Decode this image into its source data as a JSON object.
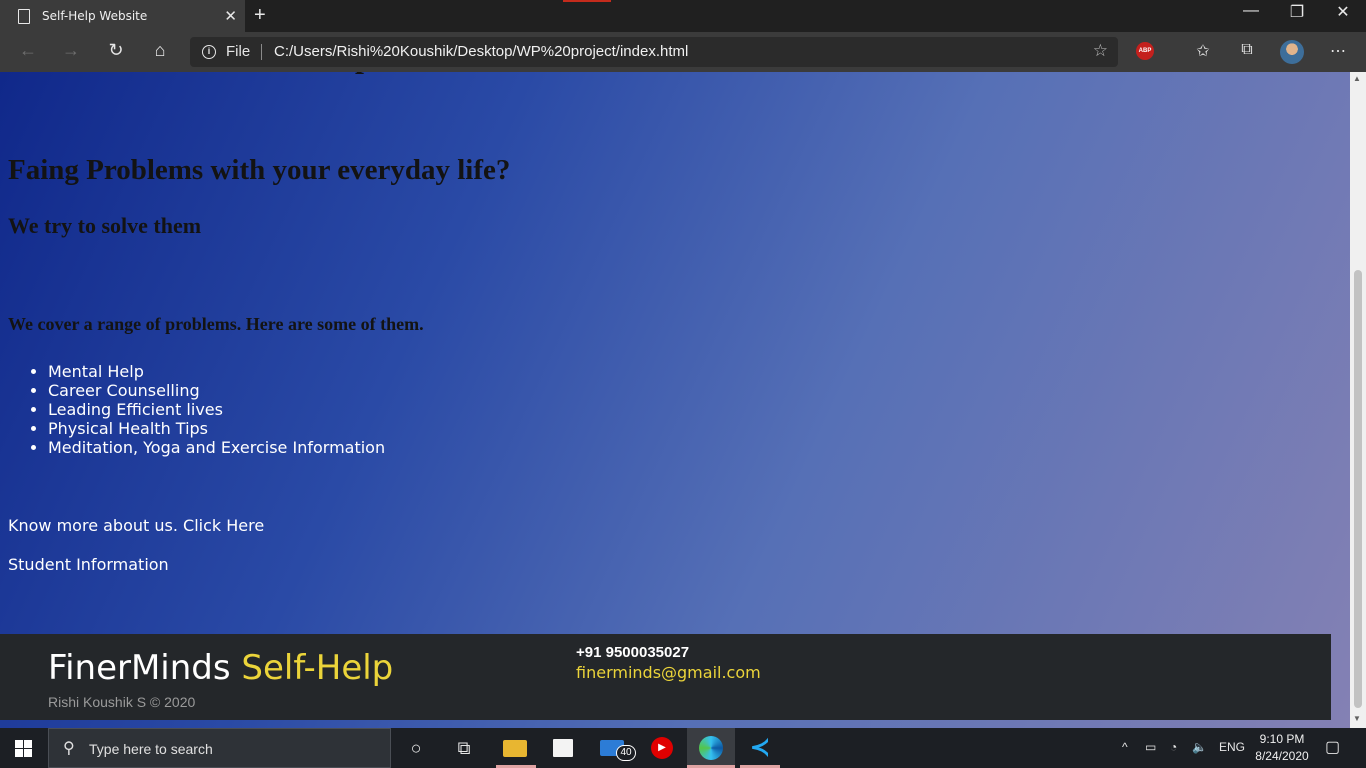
{
  "browser": {
    "tab_title": "Self-Help Website",
    "tab_close": "✕",
    "new_tab": "+",
    "window": {
      "minimize": "—",
      "restore": "❐",
      "close": "✕"
    },
    "nav": {
      "back": "←",
      "forward": "→",
      "refresh": "↻",
      "home": "⌂"
    },
    "info_icon": "i",
    "file_label": "File",
    "url": "C:/Users/Rishi%20Koushik/Desktop/WP%20project/index.html",
    "favorite": "☆",
    "abp_label": "ABP",
    "toolbar": {
      "favorites": "✩",
      "collections": "⧉",
      "more": "⋯"
    }
  },
  "page": {
    "partial_heading": "p",
    "heading_main": "Faing Problems with your everyday life?",
    "heading_sub": "We try to solve them",
    "intro": "We cover a range of problems. Here are some of them.",
    "problems": [
      "Mental Help",
      "Career Counselling",
      "Leading Efficient lives",
      "Physical Health Tips",
      "Meditation, Yoga and Exercise Information"
    ],
    "about_link": "Know more about us. Click Here",
    "student_link": "Student Information"
  },
  "footer": {
    "brand_primary": "FinerMinds",
    "brand_accent": "Self-Help",
    "copyright": "Rishi Koushik S © 2020",
    "phone": "+91 9500035027",
    "email": "finerminds@gmail.com"
  },
  "scrollbar": {
    "up": "▲",
    "down": "▼"
  },
  "taskbar": {
    "search_icon": "⚲",
    "search_placeholder": "Type here to search",
    "cortana": "○",
    "task_view": "⧉",
    "mail_badge": "40",
    "ytm_icon": "▶",
    "vscode_icon": "≺",
    "tray": {
      "chevron": "^",
      "battery": "▭",
      "wifi": "◔",
      "volume": "🔈",
      "language": "ENG",
      "notifications": "▢"
    },
    "time": "9:10 PM",
    "date": "8/24/2020"
  },
  "colors": {
    "accent_yellow": "#ebd43a",
    "footer_bg": "#24272a"
  }
}
